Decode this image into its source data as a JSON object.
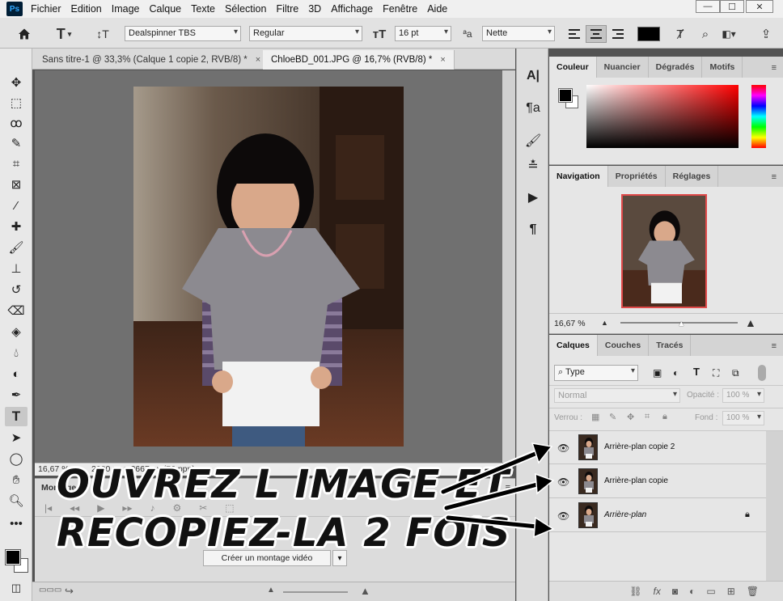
{
  "menubar": {
    "logo": "Ps",
    "items": [
      "Fichier",
      "Edition",
      "Image",
      "Calque",
      "Texte",
      "Sélection",
      "Filtre",
      "3D",
      "Affichage",
      "Fenêtre",
      "Aide"
    ]
  },
  "options": {
    "font_family": "Dealspinner TBS",
    "font_style": "Regular",
    "font_size": "16 pt",
    "antialias": "Nette"
  },
  "tabs": [
    {
      "label": "Sans titre-1 @ 33,3% (Calque 1 copie 2, RVB/8) *",
      "close": "×"
    },
    {
      "label": "ChloeBD_001.JPG @ 16,7% (RVB/8) *",
      "close": "×"
    }
  ],
  "status": {
    "zoom": "16,67 %",
    "doc_info": "2000 px x 2667 px (72 ppp)"
  },
  "timeline": {
    "title": "Montage",
    "create_button": "Créer un montage vidéo"
  },
  "color_panel": {
    "tabs": [
      "Couleur",
      "Nuancier",
      "Dégradés",
      "Motifs"
    ],
    "hue_color": "#ff0000"
  },
  "navigation_panel": {
    "tabs": [
      "Navigation",
      "Propriétés",
      "Réglages"
    ],
    "zoom": "16,67 %",
    "zoom_level": 0.52
  },
  "layers_panel": {
    "tabs": [
      "Calques",
      "Couches",
      "Tracés"
    ],
    "filter": "Type",
    "blend_mode": "Normal",
    "opacity_label": "Opacité :",
    "opacity_value": "100 %",
    "lock_label": "Verrou :",
    "fill_label": "Fond :",
    "fill_value": "100 %",
    "layers": [
      {
        "name": "Arrière-plan copie 2",
        "locked": false
      },
      {
        "name": "Arrière-plan copie",
        "locked": false
      },
      {
        "name": "Arrière-plan",
        "locked": true
      }
    ]
  },
  "overlay": {
    "line1": "Ouvrez l image et",
    "line2": "recopiez-la 2 fois"
  },
  "icons": {
    "home": "home-icon",
    "text_tool": "type-tool-icon",
    "eye": "eye-icon",
    "lock": "lock-icon"
  }
}
